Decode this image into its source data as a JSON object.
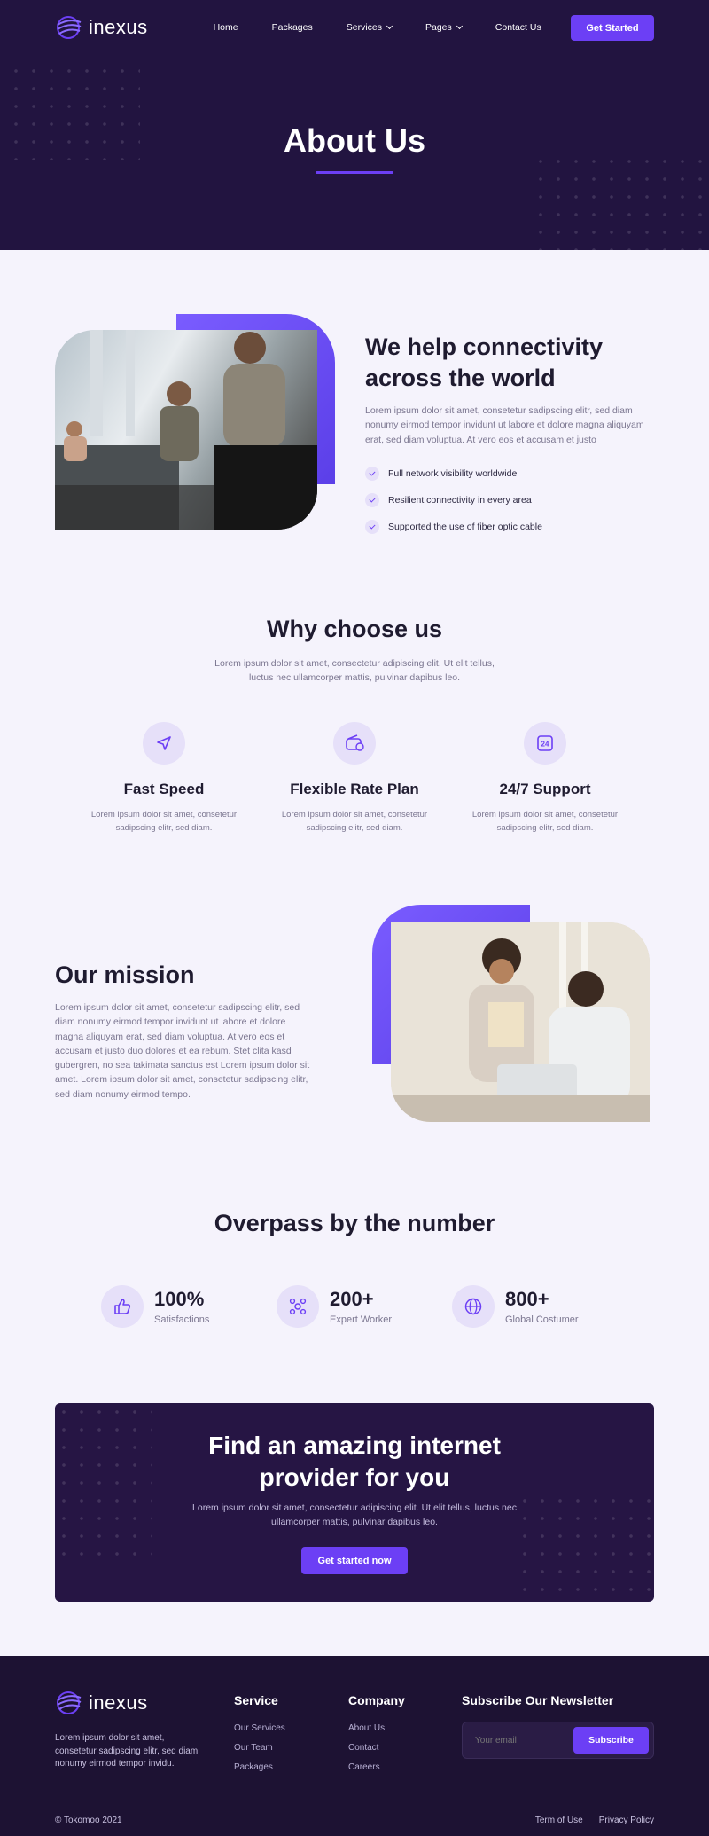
{
  "brand": {
    "name": "inexus"
  },
  "nav": {
    "items": [
      {
        "label": "Home"
      },
      {
        "label": "Packages"
      },
      {
        "label": "Services"
      },
      {
        "label": "Pages"
      },
      {
        "label": "Contact Us"
      }
    ],
    "cta": "Get Started"
  },
  "hero": {
    "title": "About Us"
  },
  "connect": {
    "title": "We help connectivity across the world",
    "text": "Lorem ipsum dolor sit amet, consetetur sadipscing elitr, sed diam nonumy eirmod tempor invidunt ut labore et dolore magna aliquyam erat, sed diam voluptua. At vero eos et accusam et justo",
    "checks": [
      "Full network visibility worldwide",
      "Resilient connectivity in every area",
      "Supported the use of fiber optic cable"
    ]
  },
  "why": {
    "title": "Why choose us",
    "text": "Lorem ipsum dolor sit amet, consectetur adipiscing elit. Ut elit tellus, luctus nec ullamcorper mattis, pulvinar dapibus leo.",
    "features": [
      {
        "icon": "paper-plane-icon",
        "title": "Fast Speed",
        "text": "Lorem ipsum dolor sit amet, consetetur sadipscing elitr, sed diam."
      },
      {
        "icon": "wallet-icon",
        "title": "Flexible Rate Plan",
        "text": "Lorem ipsum dolor sit amet, consetetur sadipscing elitr, sed diam."
      },
      {
        "icon": "support-24-icon",
        "title": "24/7 Support",
        "text": "Lorem ipsum dolor sit amet, consetetur sadipscing elitr, sed diam."
      }
    ]
  },
  "mission": {
    "title": "Our mission",
    "text": "Lorem ipsum dolor sit amet, consetetur sadipscing elitr, sed diam nonumy eirmod tempor invidunt ut labore et dolore magna aliquyam erat, sed diam voluptua. At vero eos et accusam et justo duo dolores et ea rebum. Stet clita kasd gubergren, no sea takimata sanctus est Lorem ipsum dolor sit amet. Lorem ipsum dolor sit amet, consetetur sadipscing elitr, sed diam nonumy eirmod tempo."
  },
  "numbers": {
    "title": "Overpass by the number",
    "stats": [
      {
        "icon": "thumbs-up-icon",
        "value": "100%",
        "label": "Satisfactions"
      },
      {
        "icon": "team-icon",
        "value": "200+",
        "label": "Expert Worker"
      },
      {
        "icon": "globe-icon",
        "value": "800+",
        "label": "Global Costumer"
      }
    ]
  },
  "cta": {
    "title": "Find an amazing internet provider for you",
    "text": "Lorem ipsum dolor sit amet, consectetur adipiscing elit. Ut elit tellus, luctus nec ullamcorper mattis, pulvinar dapibus leo.",
    "button": "Get started now"
  },
  "footer": {
    "about": "Lorem ipsum dolor sit amet, consetetur sadipscing elitr, sed diam nonumy eirmod tempor invidu.",
    "service": {
      "title": "Service",
      "links": [
        "Our Services",
        "Our Team",
        "Packages"
      ]
    },
    "company": {
      "title": "Company",
      "links": [
        "About Us",
        "Contact",
        "Careers"
      ]
    },
    "newsletter": {
      "title": "Subscribe Our Newsletter",
      "placeholder": "Your email",
      "button": "Subscribe"
    },
    "copyright": "© Tokomoo 2021",
    "bottom_links": [
      "Term of Use",
      "Privacy Policy"
    ]
  },
  "colors": {
    "accent": "#6c3ff5",
    "hero_bg": "#221440",
    "page_bg": "#f5f3fc",
    "footer_bg": "#1d1233"
  }
}
